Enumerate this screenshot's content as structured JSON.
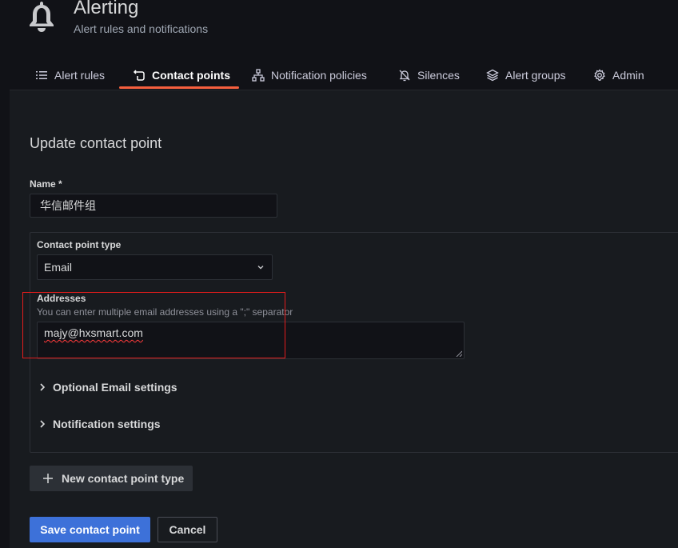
{
  "header": {
    "title": "Alerting",
    "subtitle": "Alert rules and notifications",
    "icon": "bell-icon"
  },
  "tabs": [
    {
      "label": "Alert rules",
      "icon": "list-icon",
      "active": false
    },
    {
      "label": "Contact points",
      "icon": "comment-alt-icon",
      "active": true
    },
    {
      "label": "Notification policies",
      "icon": "sitemap-icon",
      "active": false
    },
    {
      "label": "Silences",
      "icon": "bell-slash-icon",
      "active": false
    },
    {
      "label": "Alert groups",
      "icon": "layer-group-icon",
      "active": false
    },
    {
      "label": "Admin",
      "icon": "cog-icon",
      "active": false
    }
  ],
  "form": {
    "title": "Update contact point",
    "name_label": "Name *",
    "name_value": "华信邮件组",
    "contact_type_label": "Contact point type",
    "contact_type_value": "Email",
    "addresses_label": "Addresses",
    "addresses_description": "You can enter multiple email addresses using a \";\" separator",
    "addresses_value": "majy@hxsmart.com",
    "optional_settings": "Optional Email settings",
    "notification_settings": "Notification settings",
    "new_type_button": "New contact point type",
    "save_button": "Save contact point",
    "cancel_button": "Cancel"
  },
  "colors": {
    "accent": "#f55f3e",
    "primary": "#3d71d9",
    "highlight": "#e21c1c"
  }
}
